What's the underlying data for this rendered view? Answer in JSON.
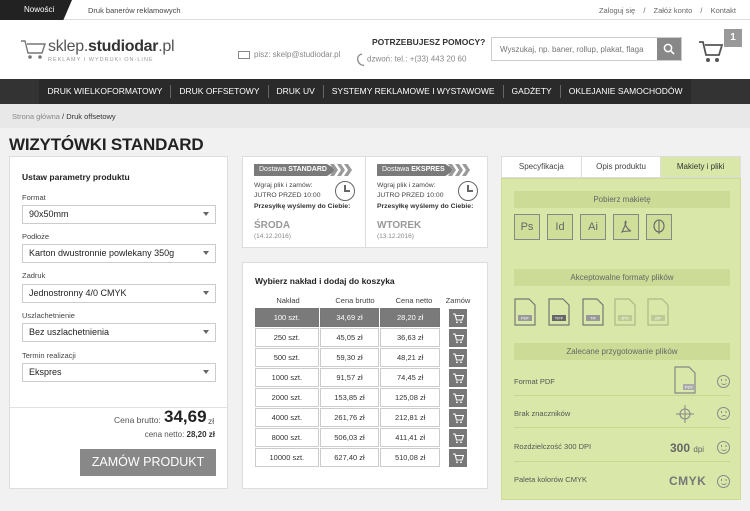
{
  "topbar": {
    "news_label": "Nowości",
    "news_text": "Druk banerów reklamowych",
    "links": [
      "Zaloguj się",
      "/",
      "Załóż konto",
      "/",
      "Kontakt"
    ]
  },
  "header": {
    "logo_main": "sklep.",
    "logo_bold": "studiodar",
    "logo_tld": ".pl",
    "logo_sub": "REKLAMY I WYDRUKI ON-LINE",
    "mail_label": "pisz: skelp@studiodar.pl",
    "help_title": "POTRZEBUJESZ POMOCY?",
    "help_phone": "dzwoń: tel.: +(33) 443 20 60",
    "search_placeholder": "Wyszukaj, np. baner, rollup, plakat, flaga",
    "cart_count": "1"
  },
  "nav": {
    "items": [
      "DRUK WIELKOFORMATOWY",
      "DRUK OFFSETOWY",
      "DRUK UV",
      "SYSTEMY REKLAMOWE I WYSTAWOWE",
      "GADŻETY",
      "OKLEJANIE SAMOCHODÓW"
    ]
  },
  "breadcrumb": {
    "home": "Strona główna",
    "current": "/ Druk offsetowy"
  },
  "page": {
    "title": "WIZYTÓWKI STANDARD"
  },
  "params": {
    "title": "Ustaw parametry produktu",
    "fields": [
      {
        "label": "Format",
        "value": "90x50mm"
      },
      {
        "label": "Podłoże",
        "value": "Karton dwustronnie powlekany 350g"
      },
      {
        "label": "Zadruk",
        "value": "Jednostronny 4/0 CMYK"
      },
      {
        "label": "Uszlachetnienie",
        "value": "Bez uszlachetnienia"
      },
      {
        "label": "Termin realizacji",
        "value": "Ekspres"
      }
    ],
    "brutto_label": "Cena brutto:",
    "brutto_value": "34,69",
    "brutto_unit": "zł",
    "netto_label": "cena netto:",
    "netto_value": "28,20 zł",
    "order_button": "ZAMÓW PRODUKT"
  },
  "delivery": [
    {
      "tag_prefix": "Dostawa",
      "tag_name": "STANDARD",
      "line1": "Wgraj plik i zamów:",
      "line2": "JUTRO PRZED 10:00",
      "line3": "Przesyłkę wyślemy do Ciebie:",
      "day": "ŚRODA",
      "date": "(14.12.2016)"
    },
    {
      "tag_prefix": "Dostawa",
      "tag_name": "EKSPRES",
      "line1": "Wgraj plik i zamów:",
      "line2": "JUTRO PRZED 10:00",
      "line3": "Przesyłkę wyślemy do Ciebie:",
      "day": "WTOREK",
      "date": "(13.12.2016)"
    }
  ],
  "quantities": {
    "title": "Wybierz nakład i dodaj do koszyka",
    "headers": [
      "Nakład",
      "Cena brutto",
      "Cena netto",
      "Zamów"
    ],
    "rows": [
      {
        "qty": "100 szt.",
        "brutto": "34,69 zł",
        "netto": "28,20 zł",
        "selected": true
      },
      {
        "qty": "250 szt.",
        "brutto": "45,05 zł",
        "netto": "36,63 zł",
        "selected": false
      },
      {
        "qty": "500 szt.",
        "brutto": "59,30 zł",
        "netto": "48,21 zł",
        "selected": false
      },
      {
        "qty": "1000 szt.",
        "brutto": "91,57 zł",
        "netto": "74,45 zł",
        "selected": false
      },
      {
        "qty": "2000 szt.",
        "brutto": "153,85 zł",
        "netto": "125,08 zł",
        "selected": false
      },
      {
        "qty": "4000 szt.",
        "brutto": "261,76 zł",
        "netto": "212,81 zł",
        "selected": false
      },
      {
        "qty": "8000 szt.",
        "brutto": "506,03 zł",
        "netto": "411,41 zł",
        "selected": false
      },
      {
        "qty": "10000 szt.",
        "brutto": "627,40 zł",
        "netto": "510,08 zł",
        "selected": false
      }
    ]
  },
  "tabs": [
    "Specyfikacja",
    "Opis produktu",
    "Makiety i pliki"
  ],
  "files": {
    "download_title": "Pobierz makietę",
    "template_icons": [
      "Ps",
      "Id",
      "Ai"
    ],
    "formats_title": "Akceptowalne formaty plików",
    "formats": [
      "PDF",
      "TIFF",
      "TIF",
      "JPG",
      "ZIP"
    ],
    "prep_title": "Zalecane przygotowanie plików",
    "prep": [
      {
        "label": "Format PDF",
        "badge": "PDF"
      },
      {
        "label": "Brak znaczników"
      },
      {
        "label": "Rozdzielczość 300 DPI",
        "dpi": "300",
        "dpi_unit": "dpi"
      },
      {
        "label": "Paleta kolorów CMYK",
        "badge": "CMYK"
      }
    ]
  },
  "colors": {
    "nav_bg": "#333333",
    "accent_green": "#d9e8a8",
    "button_grey": "#888888"
  }
}
